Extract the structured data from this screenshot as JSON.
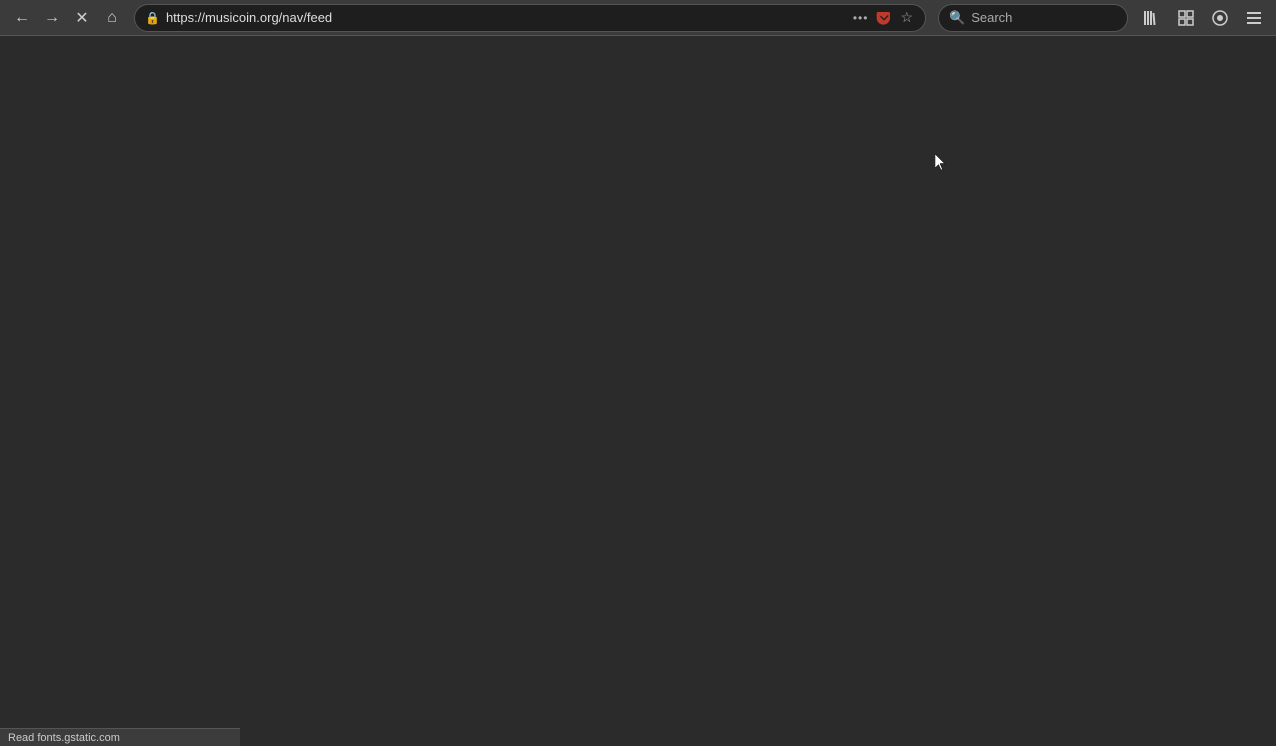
{
  "browser": {
    "nav": {
      "back_label": "←",
      "forward_label": "→",
      "close_label": "✕",
      "home_label": "⌂"
    },
    "address_bar": {
      "url": "https://musicoin.org/nav/feed",
      "more_label": "•••",
      "pocket_label": "pocket",
      "bookmark_label": "☆"
    },
    "search": {
      "placeholder": "Search"
    },
    "toolbar": {
      "library_label": "|||",
      "containers_label": "□",
      "extensions_label": "ext",
      "menu_label": "≡"
    }
  },
  "page": {
    "background_color": "#2b2b2b"
  },
  "status_bar": {
    "text": "Read fonts.gstatic.com"
  }
}
